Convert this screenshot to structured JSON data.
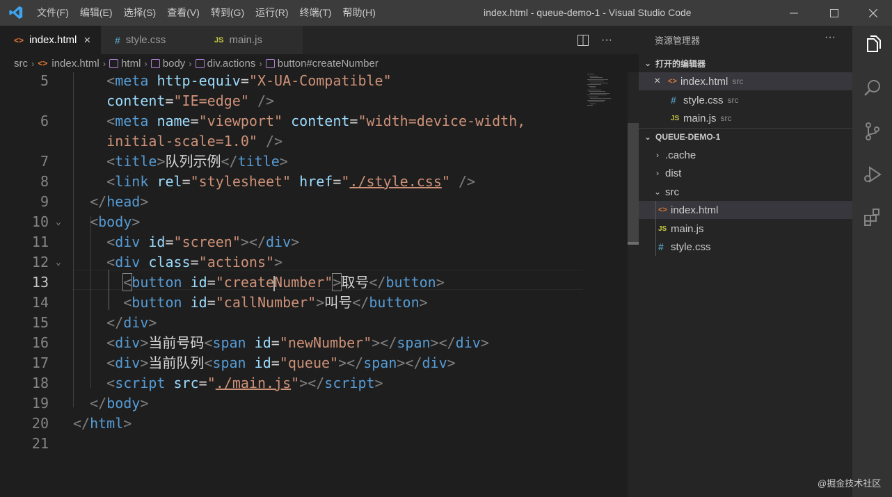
{
  "window": {
    "title": "index.html - queue-demo-1 - Visual Studio Code",
    "menu": [
      "文件(F)",
      "编辑(E)",
      "选择(S)",
      "查看(V)",
      "转到(G)",
      "运行(R)",
      "终端(T)",
      "帮助(H)"
    ]
  },
  "tabs": [
    {
      "label": "index.html",
      "icon": "<>",
      "type": "html"
    },
    {
      "label": "style.css",
      "icon": "#",
      "type": "css"
    },
    {
      "label": "main.js",
      "icon": "JS",
      "type": "js"
    }
  ],
  "breadcrumb": [
    "src",
    "index.html",
    "html",
    "body",
    "div.actions",
    "button#createNumber"
  ],
  "editor": {
    "lines": [
      {
        "n": "5",
        "tokens": [
          {
            "c": "p",
            "v": "<"
          },
          {
            "c": "t",
            "v": "meta"
          },
          {
            "c": "x",
            "v": " "
          },
          {
            "c": "a",
            "v": "http-equiv"
          },
          {
            "c": "x",
            "v": "="
          },
          {
            "c": "s",
            "v": "\"X-UA-Compatible\""
          }
        ]
      },
      {
        "n": "",
        "tokens": [
          {
            "c": "a",
            "v": "content"
          },
          {
            "c": "x",
            "v": "="
          },
          {
            "c": "s",
            "v": "\"IE=edge\""
          },
          {
            "c": "x",
            "v": " "
          },
          {
            "c": "p",
            "v": "/>"
          }
        ]
      },
      {
        "n": "6",
        "tokens": [
          {
            "c": "p",
            "v": "<"
          },
          {
            "c": "t",
            "v": "meta"
          },
          {
            "c": "x",
            "v": " "
          },
          {
            "c": "a",
            "v": "name"
          },
          {
            "c": "x",
            "v": "="
          },
          {
            "c": "s",
            "v": "\"viewport\""
          },
          {
            "c": "x",
            "v": " "
          },
          {
            "c": "a",
            "v": "content"
          },
          {
            "c": "x",
            "v": "="
          },
          {
            "c": "s",
            "v": "\"width=device-width,"
          }
        ]
      },
      {
        "n": "",
        "tokens": [
          {
            "c": "s",
            "v": "initial-scale=1.0\""
          },
          {
            "c": "x",
            "v": " "
          },
          {
            "c": "p",
            "v": "/>"
          }
        ]
      },
      {
        "n": "7",
        "tokens": [
          {
            "c": "p",
            "v": "<"
          },
          {
            "c": "t",
            "v": "title"
          },
          {
            "c": "p",
            "v": ">"
          },
          {
            "c": "x",
            "v": "队列示例"
          },
          {
            "c": "p",
            "v": "</"
          },
          {
            "c": "t",
            "v": "title"
          },
          {
            "c": "p",
            "v": ">"
          }
        ]
      },
      {
        "n": "8",
        "tokens": [
          {
            "c": "p",
            "v": "<"
          },
          {
            "c": "t",
            "v": "link"
          },
          {
            "c": "x",
            "v": " "
          },
          {
            "c": "a",
            "v": "rel"
          },
          {
            "c": "x",
            "v": "="
          },
          {
            "c": "s",
            "v": "\"stylesheet\""
          },
          {
            "c": "x",
            "v": " "
          },
          {
            "c": "a",
            "v": "href"
          },
          {
            "c": "x",
            "v": "="
          },
          {
            "c": "s",
            "v": "\""
          },
          {
            "c": "su",
            "v": "./style.css"
          },
          {
            "c": "s",
            "v": "\""
          },
          {
            "c": "x",
            "v": " "
          },
          {
            "c": "p",
            "v": "/>"
          }
        ]
      },
      {
        "n": "9",
        "tokens": [
          {
            "c": "p",
            "v": "</"
          },
          {
            "c": "t",
            "v": "head"
          },
          {
            "c": "p",
            "v": ">"
          }
        ]
      },
      {
        "n": "10",
        "tokens": [
          {
            "c": "p",
            "v": "<"
          },
          {
            "c": "t",
            "v": "body"
          },
          {
            "c": "p",
            "v": ">"
          }
        ]
      },
      {
        "n": "11",
        "tokens": [
          {
            "c": "p",
            "v": "<"
          },
          {
            "c": "t",
            "v": "div"
          },
          {
            "c": "x",
            "v": " "
          },
          {
            "c": "a",
            "v": "id"
          },
          {
            "c": "x",
            "v": "="
          },
          {
            "c": "s",
            "v": "\"screen\""
          },
          {
            "c": "p",
            "v": "></"
          },
          {
            "c": "t",
            "v": "div"
          },
          {
            "c": "p",
            "v": ">"
          }
        ]
      },
      {
        "n": "12",
        "tokens": [
          {
            "c": "p",
            "v": "<"
          },
          {
            "c": "t",
            "v": "div"
          },
          {
            "c": "x",
            "v": " "
          },
          {
            "c": "a",
            "v": "class"
          },
          {
            "c": "x",
            "v": "="
          },
          {
            "c": "s",
            "v": "\"actions\""
          },
          {
            "c": "p",
            "v": ">"
          }
        ]
      },
      {
        "n": "13",
        "tokens": [
          {
            "c": "pb",
            "v": "<"
          },
          {
            "c": "t",
            "v": "button"
          },
          {
            "c": "x",
            "v": " "
          },
          {
            "c": "a",
            "v": "id"
          },
          {
            "c": "x",
            "v": "="
          },
          {
            "c": "s",
            "v": "\"create"
          },
          {
            "c": "cursor",
            "v": ""
          },
          {
            "c": "s",
            "v": "Number\""
          },
          {
            "c": "pb",
            "v": ">"
          },
          {
            "c": "x",
            "v": "取号"
          },
          {
            "c": "p",
            "v": "</"
          },
          {
            "c": "t",
            "v": "button"
          },
          {
            "c": "p",
            "v": ">"
          }
        ]
      },
      {
        "n": "14",
        "tokens": [
          {
            "c": "p",
            "v": "<"
          },
          {
            "c": "t",
            "v": "button"
          },
          {
            "c": "x",
            "v": " "
          },
          {
            "c": "a",
            "v": "id"
          },
          {
            "c": "x",
            "v": "="
          },
          {
            "c": "s",
            "v": "\"callNumber\""
          },
          {
            "c": "p",
            "v": ">"
          },
          {
            "c": "x",
            "v": "叫号"
          },
          {
            "c": "p",
            "v": "</"
          },
          {
            "c": "t",
            "v": "button"
          },
          {
            "c": "p",
            "v": ">"
          }
        ]
      },
      {
        "n": "15",
        "tokens": [
          {
            "c": "p",
            "v": "</"
          },
          {
            "c": "t",
            "v": "div"
          },
          {
            "c": "p",
            "v": ">"
          }
        ]
      },
      {
        "n": "16",
        "tokens": [
          {
            "c": "p",
            "v": "<"
          },
          {
            "c": "t",
            "v": "div"
          },
          {
            "c": "p",
            "v": ">"
          },
          {
            "c": "x",
            "v": "当前号码"
          },
          {
            "c": "p",
            "v": "<"
          },
          {
            "c": "t",
            "v": "span"
          },
          {
            "c": "x",
            "v": " "
          },
          {
            "c": "a",
            "v": "id"
          },
          {
            "c": "x",
            "v": "="
          },
          {
            "c": "s",
            "v": "\"newNumber\""
          },
          {
            "c": "p",
            "v": "></"
          },
          {
            "c": "t",
            "v": "span"
          },
          {
            "c": "p",
            "v": "></"
          },
          {
            "c": "t",
            "v": "div"
          },
          {
            "c": "p",
            "v": ">"
          }
        ]
      },
      {
        "n": "17",
        "tokens": [
          {
            "c": "p",
            "v": "<"
          },
          {
            "c": "t",
            "v": "div"
          },
          {
            "c": "p",
            "v": ">"
          },
          {
            "c": "x",
            "v": "当前队列"
          },
          {
            "c": "p",
            "v": "<"
          },
          {
            "c": "t",
            "v": "span"
          },
          {
            "c": "x",
            "v": " "
          },
          {
            "c": "a",
            "v": "id"
          },
          {
            "c": "x",
            "v": "="
          },
          {
            "c": "s",
            "v": "\"queue\""
          },
          {
            "c": "p",
            "v": "></"
          },
          {
            "c": "t",
            "v": "span"
          },
          {
            "c": "p",
            "v": "></"
          },
          {
            "c": "t",
            "v": "div"
          },
          {
            "c": "p",
            "v": ">"
          }
        ]
      },
      {
        "n": "18",
        "tokens": [
          {
            "c": "p",
            "v": "<"
          },
          {
            "c": "t",
            "v": "script"
          },
          {
            "c": "x",
            "v": " "
          },
          {
            "c": "a",
            "v": "src"
          },
          {
            "c": "x",
            "v": "="
          },
          {
            "c": "s",
            "v": "\""
          },
          {
            "c": "su",
            "v": "./main.js"
          },
          {
            "c": "s",
            "v": "\""
          },
          {
            "c": "p",
            "v": "></"
          },
          {
            "c": "t",
            "v": "script"
          },
          {
            "c": "p",
            "v": ">"
          }
        ]
      },
      {
        "n": "19",
        "tokens": [
          {
            "c": "p",
            "v": "</"
          },
          {
            "c": "t",
            "v": "body"
          },
          {
            "c": "p",
            "v": ">"
          }
        ]
      },
      {
        "n": "20",
        "tokens": [
          {
            "c": "p",
            "v": "</"
          },
          {
            "c": "t",
            "v": "html"
          },
          {
            "c": "p",
            "v": ">"
          }
        ]
      },
      {
        "n": "21",
        "tokens": []
      }
    ]
  },
  "explorer": {
    "title": "资源管理器",
    "open_editors_label": "打开的编辑器",
    "open_editors": [
      {
        "name": "index.html",
        "desc": "src",
        "type": "html"
      },
      {
        "name": "style.css",
        "desc": "src",
        "type": "css"
      },
      {
        "name": "main.js",
        "desc": "src",
        "type": "js"
      }
    ],
    "project_label": "QUEUE-DEMO-1",
    "tree": [
      {
        "name": ".cache",
        "kind": "folder",
        "open": false
      },
      {
        "name": "dist",
        "kind": "folder",
        "open": false
      },
      {
        "name": "src",
        "kind": "folder",
        "open": true
      },
      {
        "name": "index.html",
        "kind": "html"
      },
      {
        "name": "main.js",
        "kind": "js"
      },
      {
        "name": "style.css",
        "kind": "css"
      }
    ]
  },
  "activity_icons": [
    "files-icon",
    "search-icon",
    "source-control-icon",
    "run-debug-icon",
    "extensions-icon"
  ],
  "watermark": "@掘金技术社区",
  "colors": {
    "tag": "#569cd6",
    "attr": "#9cdcfe",
    "string": "#ce9178",
    "punct": "#808080",
    "accent": "#007acc"
  }
}
